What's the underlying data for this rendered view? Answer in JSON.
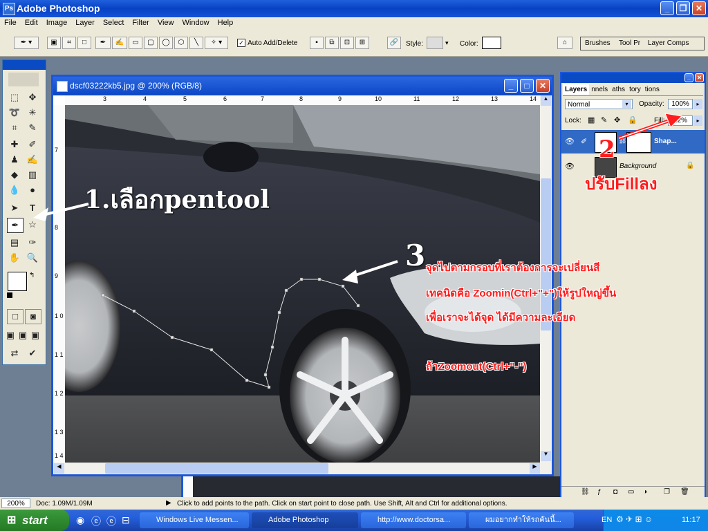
{
  "app": {
    "title": "Adobe Photoshop"
  },
  "menu": [
    "File",
    "Edit",
    "Image",
    "Layer",
    "Select",
    "Filter",
    "View",
    "Window",
    "Help"
  ],
  "options": {
    "auto_add_delete": "Auto Add/Delete",
    "style_label": "Style:",
    "color_label": "Color:",
    "palette_tabs": [
      "Brushes",
      "Tool Pr",
      "Layer Comps"
    ]
  },
  "document": {
    "title": "dscf03222kb5.jpg @ 200% (RGB/8)"
  },
  "rulers": {
    "h_ticks": [
      "3",
      "4",
      "5",
      "6",
      "7",
      "8",
      "9",
      "10",
      "11",
      "12",
      "13",
      "14"
    ],
    "v_ticks": [
      "7",
      "8",
      "9",
      "1 0",
      "1 1",
      "1 2",
      "1 3",
      "1 4"
    ]
  },
  "layers_panel": {
    "tabs": [
      "Layers",
      "nnels",
      "aths",
      "tory",
      "tions"
    ],
    "blend_mode": "Normal",
    "opacity_label": "Opacity:",
    "opacity_value": "100%",
    "lock_label": "Lock:",
    "fill_label": "Fill:",
    "fill_value": "12%",
    "layers": [
      {
        "name": "Shap..."
      },
      {
        "name": "Background"
      }
    ]
  },
  "annotations": {
    "step1": "1.เลือกpentool",
    "step2_num": "2",
    "step2_text": "ปรับFillลง",
    "step3_num": "3",
    "step3_line1": "จุดไปตามกรอบที่เราต้องการจะเปลี่ยนสี",
    "step3_line2": "เทคนิดคือ Zoomin(Ctrl+\"+\")ให้รูปใหญ่ขึ้น",
    "step3_line3": "เพื่อเราจะได้จุด ได้มีความละเอียด",
    "step3_line4": "ถ้าZoomout(Ctrl+\"-\")"
  },
  "status": {
    "zoom": "200%",
    "doc": "Doc: 1.09M/1.09M",
    "hint": "Click to add points to the path.  Click on start point to close path.  Use Shift, Alt and Ctrl for additional options."
  },
  "taskbar": {
    "start": "start",
    "tasks": [
      {
        "label": "Windows Live Messen..."
      },
      {
        "label": "Adobe Photoshop"
      },
      {
        "label": "http://www.doctorsa..."
      },
      {
        "label": "ผมอยากทำให้รถคันนี้..."
      }
    ],
    "lang": "EN",
    "clock": "11:17"
  },
  "colors": {
    "xp_blue": "#0a4bc4",
    "annotation_red": "#ff1c1c",
    "panel_bg": "#ece9d8"
  }
}
